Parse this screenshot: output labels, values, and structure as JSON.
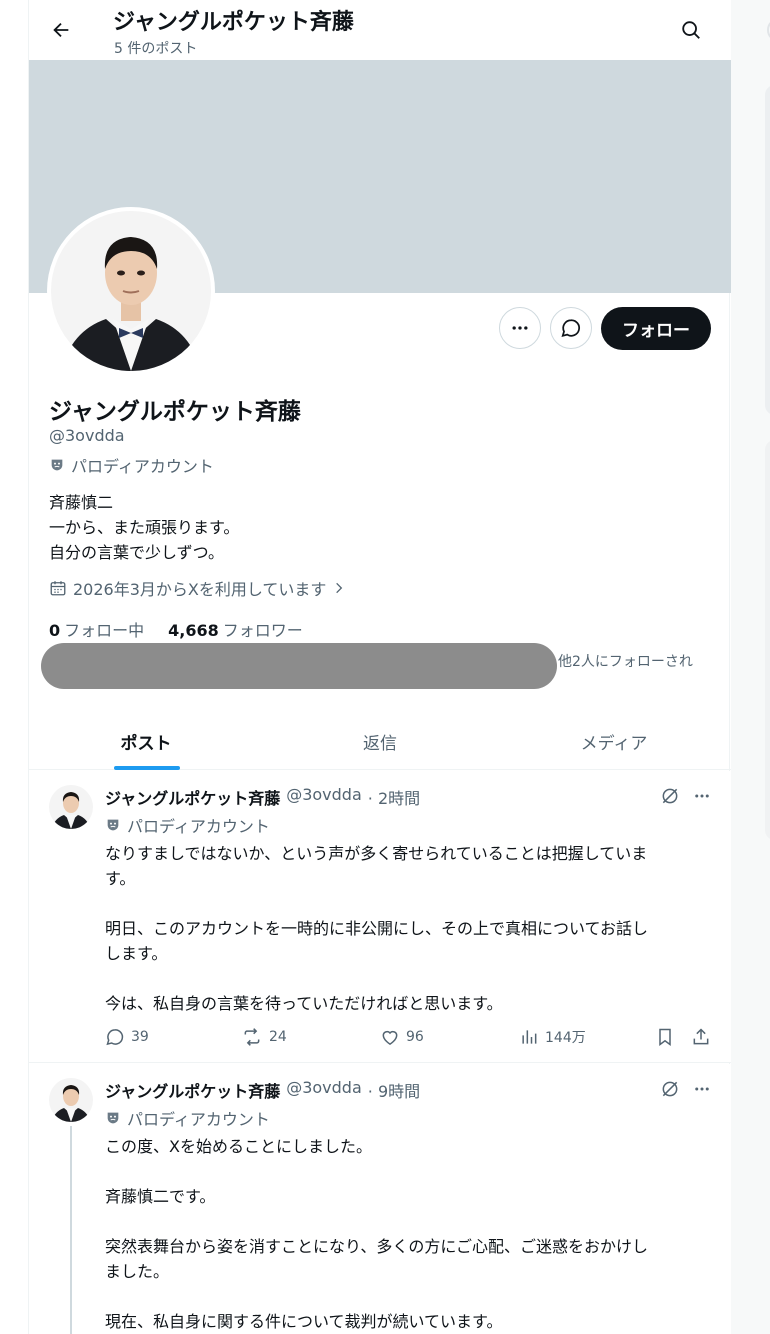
{
  "header": {
    "title": "ジャングルポケット斉藤",
    "post_count": "5 件のポスト"
  },
  "profile": {
    "name": "ジャングルポケット斉藤",
    "handle": "@3ovdda",
    "parody_label": "パロディアカウント",
    "bio": [
      "斉藤慎二",
      "一から、また頑張ります。",
      "自分の言葉で少しずつ。"
    ],
    "joined": "2026年3月からXを利用しています",
    "following_count": "0",
    "following_label": "フォロー中",
    "followers_count": "4,668",
    "followers_label": "フォロワー",
    "followed_by": "他2人にフォローされ",
    "follow_button": "フォロー"
  },
  "tabs": [
    {
      "label": "ポスト",
      "active": true
    },
    {
      "label": "返信",
      "active": false
    },
    {
      "label": "メディア",
      "active": false
    }
  ],
  "posts": [
    {
      "name": "ジャングルポケット斉藤",
      "handle": "@3ovdda",
      "time": "· 2時間",
      "parody_label": "パロディアカウント",
      "text": "なりすましではないか、という声が多く寄せられていることは把握していま\nす。\n\n明日、このアカウントを一時的に非公開にし、その上で真相についてお話し\nします。\n\n今は、私自身の言葉を待っていただければと思います。",
      "replies": "39",
      "reposts": "24",
      "likes": "96",
      "views": "144万"
    },
    {
      "name": "ジャングルポケット斉藤",
      "handle": "@3ovdda",
      "time": "· 9時間",
      "parody_label": "パロディアカウント",
      "text": "この度、Xを始めることにしました。\n\n斉藤慎二です。\n\n突然表舞台から姿を消すことになり、多くの方にご心配、ご迷惑をおかけし\nました。\n\n現在、私自身に関する件について裁判が続いています。"
    }
  ],
  "colors": {
    "accent": "#1d9bf0",
    "text": "#0f1419",
    "muted": "#536471",
    "banner": "#cfd9de"
  }
}
